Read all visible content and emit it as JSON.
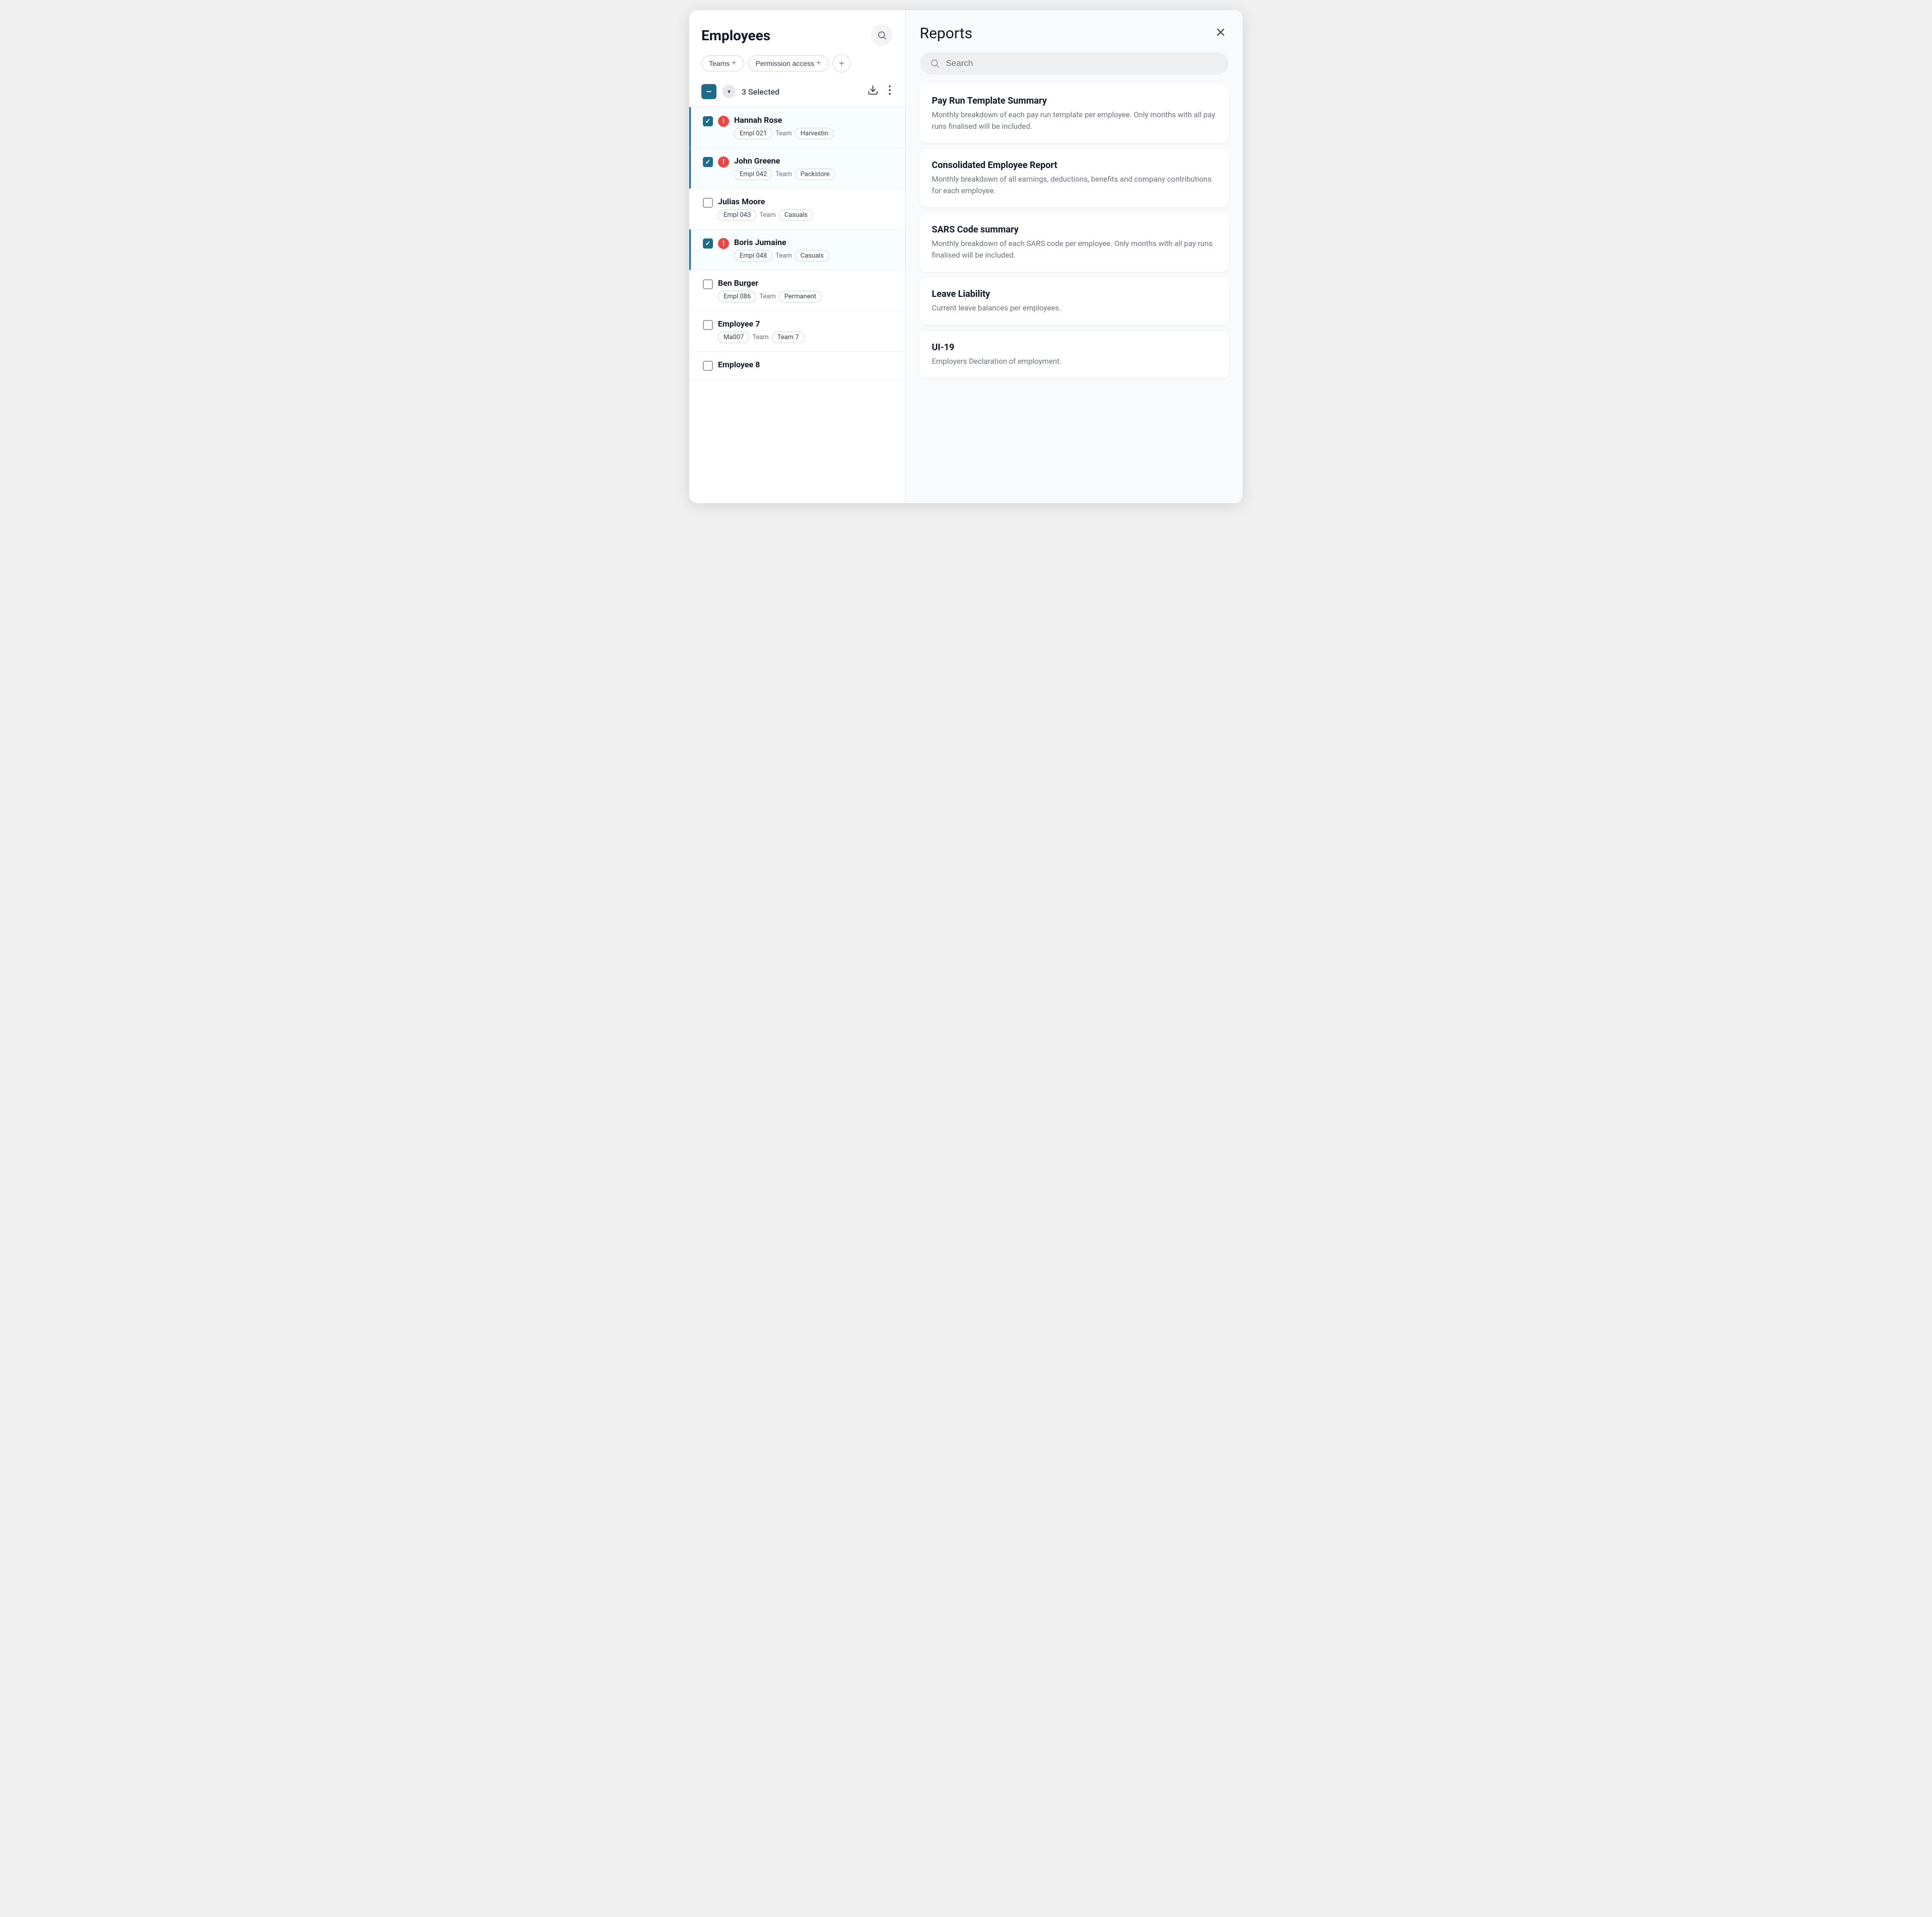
{
  "left": {
    "title": "Employees",
    "filters": [
      {
        "label": "Teams",
        "id": "teams-filter"
      },
      {
        "label": "Permission access",
        "id": "permission-filter"
      }
    ],
    "selection": {
      "count_label": "3 Selected"
    },
    "employees": [
      {
        "id": "emp-1",
        "name": "Hannah Rose",
        "selected": true,
        "alert": true,
        "emp_id": "Empl 021",
        "team_label": "Team",
        "team": "Harvestin"
      },
      {
        "id": "emp-2",
        "name": "John Greene",
        "selected": true,
        "alert": true,
        "emp_id": "Empl 042",
        "team_label": "Team",
        "team": "Packstore"
      },
      {
        "id": "emp-3",
        "name": "Julias Moore",
        "selected": false,
        "alert": false,
        "emp_id": "Empl 043",
        "team_label": "Team",
        "team": "Casuals"
      },
      {
        "id": "emp-4",
        "name": "Boris Jumaine",
        "selected": true,
        "alert": true,
        "emp_id": "Empl 048",
        "team_label": "Team",
        "team": "Casuals"
      },
      {
        "id": "emp-5",
        "name": "Ben Burger",
        "selected": false,
        "alert": false,
        "emp_id": "Empl 086",
        "team_label": "Team",
        "team": "Permanent"
      },
      {
        "id": "emp-6",
        "name": "Employee 7",
        "selected": false,
        "alert": false,
        "emp_id": "Ma007",
        "team_label": "Team",
        "team": "Team 7"
      },
      {
        "id": "emp-7",
        "name": "Employee 8",
        "selected": false,
        "alert": false,
        "emp_id": "",
        "team_label": "",
        "team": ""
      }
    ]
  },
  "right": {
    "title": "Reports",
    "search_placeholder": "Search",
    "close_label": "×",
    "reports": [
      {
        "id": "report-1",
        "title": "Pay Run Template Summary",
        "description": "Monthly breakdown of each pay run template per employee. Only months with all pay runs finalised will be included."
      },
      {
        "id": "report-2",
        "title": "Consolidated Employee Report",
        "description": "Monthly breakdown of all earnings, deductions, benefits and company contributions for each employee."
      },
      {
        "id": "report-3",
        "title": "SARS Code summary",
        "description": "Monthly breakdown of each SARS code per employee. Only months with all pay runs finalised will be included."
      },
      {
        "id": "report-4",
        "title": "Leave Liability",
        "description": "Current leave balances per employees."
      },
      {
        "id": "report-5",
        "title": "UI-19",
        "description": "Employers Declaration of employment."
      }
    ]
  }
}
